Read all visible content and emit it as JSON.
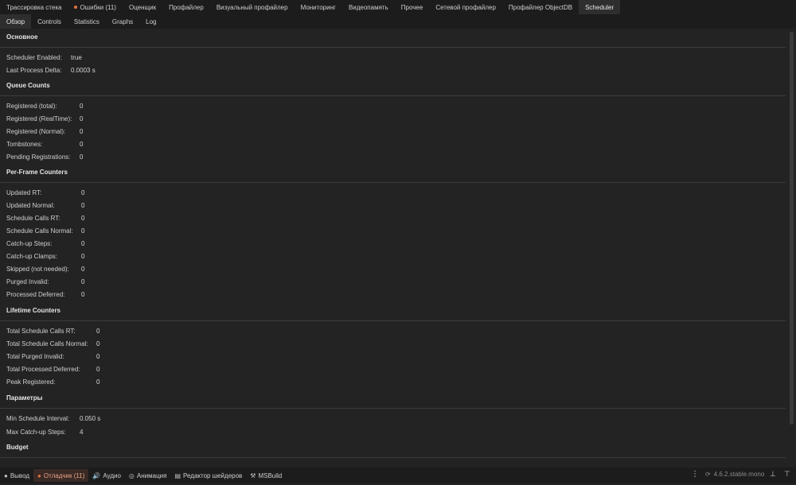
{
  "top_tabs": [
    {
      "label": "Трассировка стека"
    },
    {
      "label": "Ошибки (11)"
    },
    {
      "label": "Оценщик"
    },
    {
      "label": "Профайлер"
    },
    {
      "label": "Визуальный профайлер"
    },
    {
      "label": "Мониторинг"
    },
    {
      "label": "Видеопамять"
    },
    {
      "label": "Прочее"
    },
    {
      "label": "Сетевой профайлер"
    },
    {
      "label": "Профайлер ObjectDB"
    },
    {
      "label": "Scheduler"
    }
  ],
  "sub_tabs": [
    {
      "label": "Обзор"
    },
    {
      "label": "Controls"
    },
    {
      "label": "Statistics"
    },
    {
      "label": "Graphs"
    },
    {
      "label": "Log"
    }
  ],
  "sections": {
    "basic": {
      "title": "Основное",
      "rows": [
        {
          "label": "Scheduler Enabled:",
          "value": "true"
        },
        {
          "label": "Last Process Delta:",
          "value": "0.0003 s"
        }
      ]
    },
    "queue": {
      "title": "Queue Counts",
      "rows": [
        {
          "label": "Registered (total):",
          "value": "0"
        },
        {
          "label": "Registered (RealTime):",
          "value": "0"
        },
        {
          "label": "Registered (Normal):",
          "value": "0"
        },
        {
          "label": "Tombstones:",
          "value": "0"
        },
        {
          "label": "Pending Registrations:",
          "value": "0"
        }
      ]
    },
    "perframe": {
      "title": "Per-Frame Counters",
      "rows": [
        {
          "label": "Updated RT:",
          "value": "0"
        },
        {
          "label": "Updated Normal:",
          "value": "0"
        },
        {
          "label": "Schedule Calls RT:",
          "value": "0"
        },
        {
          "label": "Schedule Calls Normal:",
          "value": "0"
        },
        {
          "label": "Catch-up Steps:",
          "value": "0"
        },
        {
          "label": "Catch-up Clamps:",
          "value": "0"
        },
        {
          "label": "Skipped (not needed):",
          "value": "0"
        },
        {
          "label": "Purged Invalid:",
          "value": "0"
        },
        {
          "label": "Processed Deferred:",
          "value": "0"
        }
      ]
    },
    "lifetime": {
      "title": "Lifetime Counters",
      "rows": [
        {
          "label": "Total Schedule Calls RT:",
          "value": "0"
        },
        {
          "label": "Total Schedule Calls Normal:",
          "value": "0"
        },
        {
          "label": "Total Purged Invalid:",
          "value": "0"
        },
        {
          "label": "Total Processed Deferred:",
          "value": "0"
        },
        {
          "label": "Peak Registered:",
          "value": "0"
        }
      ]
    },
    "params": {
      "title": "Параметры",
      "rows": [
        {
          "label": "Min Schedule Interval:",
          "value": "0.050 s"
        },
        {
          "label": "Max Catch-up Steps:",
          "value": "4"
        }
      ]
    },
    "budget": {
      "title": "Budget"
    }
  },
  "bottom_bar": {
    "items": [
      {
        "label": "Вывод",
        "icon": "output-icon"
      },
      {
        "label": "Отладчик (11)",
        "icon": "debugger-icon"
      },
      {
        "label": "Аудио",
        "icon": "audio-icon"
      },
      {
        "label": "Анимация",
        "icon": "animation-icon"
      },
      {
        "label": "Редактор шейдеров",
        "icon": "shader-editor-icon"
      },
      {
        "label": "MSBuild",
        "icon": "msbuild-icon"
      }
    ],
    "version": "4.6.2.stable.mono"
  },
  "colors": {
    "accent": "#e0733c",
    "background": "#232323",
    "tabbar": "#1c1c1c"
  }
}
